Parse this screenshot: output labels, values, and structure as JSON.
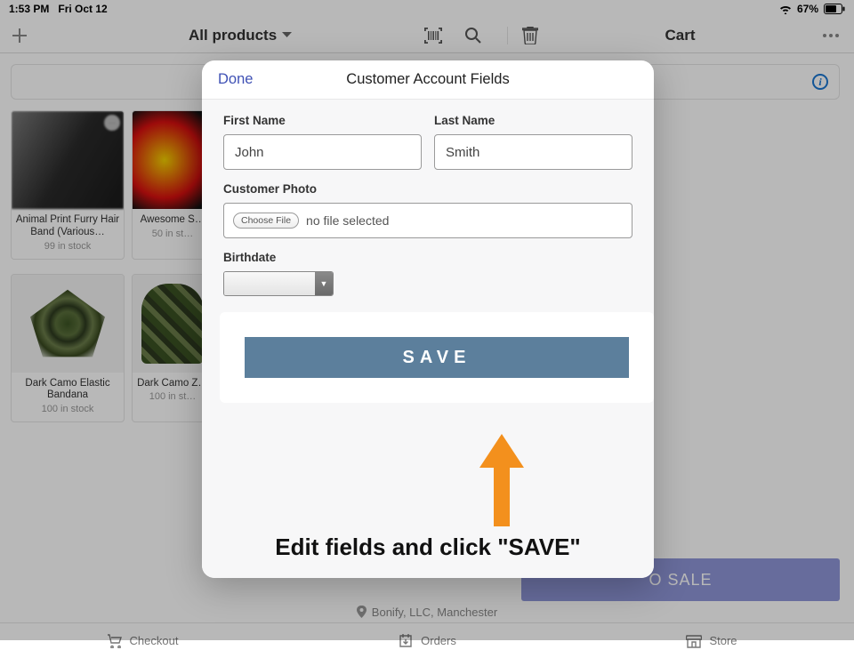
{
  "status": {
    "time": "1:53 PM",
    "date": "Fri Oct 12",
    "battery_pct": "67%"
  },
  "topbar": {
    "all_products": "All products",
    "cart": "Cart"
  },
  "products": [
    {
      "name": "Animal Print Furry Hair Band (Various…",
      "stock": "99 in stock"
    },
    {
      "name": "Awesome S…",
      "stock": "50 in st…"
    },
    {
      "name": "Dark Camo Elastic Bandana",
      "stock": "100 in stock"
    },
    {
      "name": "Dark Camo Z…",
      "stock": "100 in st…"
    }
  ],
  "cart": {
    "add_to_sale": "O SALE"
  },
  "footer": {
    "address": "Bonify, LLC, Manchester",
    "nav": {
      "checkout": "Checkout",
      "orders": "Orders",
      "store": "Store"
    }
  },
  "modal": {
    "done": "Done",
    "title": "Customer Account Fields",
    "labels": {
      "first_name": "First Name",
      "last_name": "Last Name",
      "photo": "Customer Photo",
      "birthdate": "Birthdate"
    },
    "values": {
      "first_name": "John",
      "last_name": "Smith"
    },
    "file": {
      "choose": "Choose File",
      "none": "no file selected"
    },
    "save": "SAVE",
    "instruction": "Edit fields and click \"SAVE\""
  },
  "colors": {
    "accent_arrow": "#F3901D",
    "save_bg": "#5c7f9c",
    "link": "#3F51B5"
  }
}
